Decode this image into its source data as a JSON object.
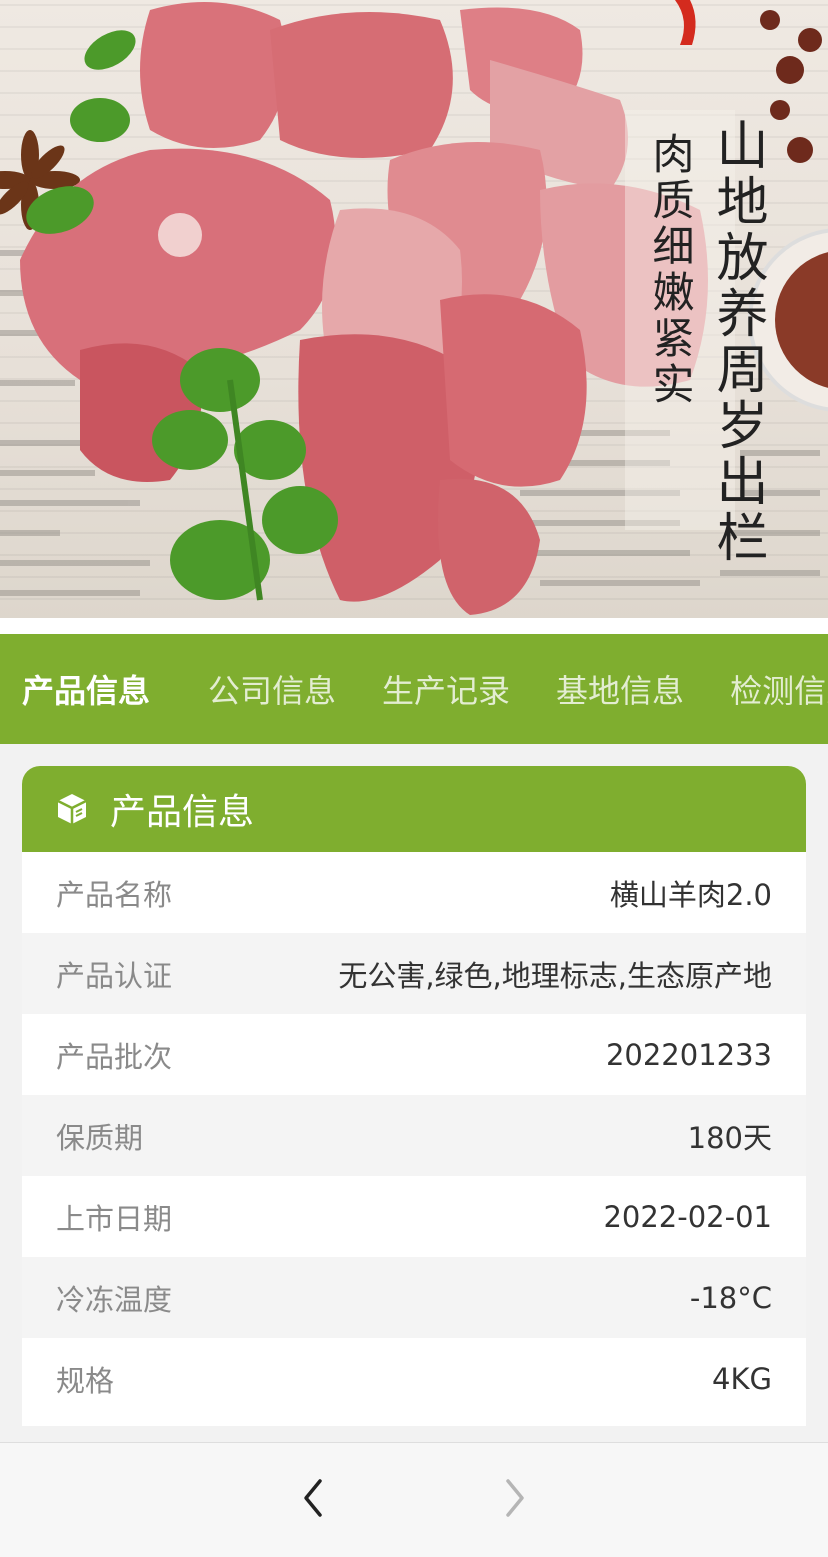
{
  "hero": {
    "slogan_1": "山地放养周岁出栏",
    "slogan_2": "肉质细嫩紧实"
  },
  "tabs": [
    {
      "label": "产品信息",
      "active": true
    },
    {
      "label": "公司信息",
      "active": false
    },
    {
      "label": "生产记录",
      "active": false
    },
    {
      "label": "基地信息",
      "active": false
    },
    {
      "label": "检测信息",
      "active": false
    }
  ],
  "card": {
    "icon": "box-icon",
    "title": "产品信息",
    "rows": [
      {
        "key": "产品名称",
        "value": "横山羊肉2.0"
      },
      {
        "key": "产品认证",
        "value": "无公害,绿色,地理标志,生态原产地"
      },
      {
        "key": "产品批次",
        "value": "202201233"
      },
      {
        "key": "保质期",
        "value": "180天"
      },
      {
        "key": "上市日期",
        "value": "2022-02-01"
      },
      {
        "key": "冷冻温度",
        "value": "-18°C"
      },
      {
        "key": "规格",
        "value": "4KG"
      }
    ]
  },
  "nav": {
    "back_icon": "chevron-left-icon",
    "forward_icon": "chevron-right-icon"
  },
  "colors": {
    "accent": "#7fae2f",
    "meat": "#d9727a",
    "cilantro": "#4c9a2a"
  }
}
